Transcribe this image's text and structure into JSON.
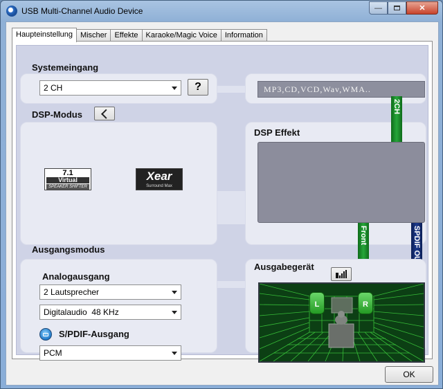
{
  "window": {
    "title": "USB Multi-Channel Audio Device"
  },
  "tabs": [
    {
      "label": "Haupteinstellung",
      "active": true
    },
    {
      "label": "Mischer"
    },
    {
      "label": "Effekte"
    },
    {
      "label": "Karaoke/Magic Voice"
    },
    {
      "label": "Information"
    }
  ],
  "system_input": {
    "label": "Systemeingang",
    "selected": "2 CH",
    "help_button": "?",
    "sources_text": "MP3,CD,VCD,Wav,WMA.."
  },
  "dsp_mode": {
    "label": "DSP-Modus",
    "logo_71": {
      "line1": "7.1",
      "line2": "Virtual",
      "line3": "SPEAKER SHIFTER"
    },
    "logo_xear": {
      "line1": "Xear",
      "line2": "Surround Max"
    }
  },
  "dsp_effect": {
    "label": "DSP Effekt"
  },
  "connectors": {
    "two_ch": "2CH",
    "front": "Front",
    "spdif_out": "SPDIF OUT"
  },
  "output_mode": {
    "label": "Ausgangsmodus",
    "analog_label": "Analogausgang",
    "analog_selected": "2 Lautsprecher",
    "digital_selected": "Digitalaudio  48 KHz",
    "spdif_label": "S/PDIF-Ausgang",
    "spdif_selected": "PCM"
  },
  "output_device": {
    "label": "Ausgabegerät",
    "left_speaker": "L",
    "right_speaker": "R"
  },
  "footer": {
    "ok_label": "OK"
  },
  "colors": {
    "green_bar": "#26a63a",
    "blue_bar": "#1d3a8c",
    "room_grid": "#3fd43f"
  }
}
